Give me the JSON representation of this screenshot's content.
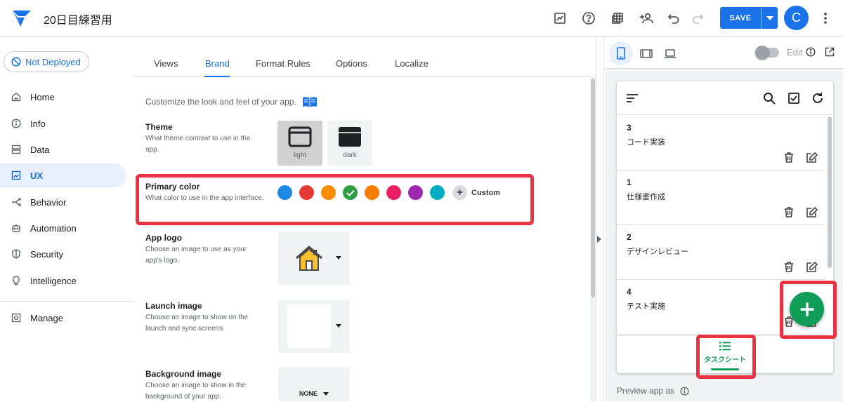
{
  "app": {
    "title": "20日目練習用"
  },
  "topbar": {
    "icons": [
      "chart-icon",
      "help-icon",
      "grid-icon",
      "add-person-icon",
      "undo-icon",
      "redo-icon"
    ],
    "save_label": "SAVE",
    "avatar_initial": "C"
  },
  "sidebar": {
    "deploy_status": "Not Deployed",
    "items": [
      {
        "label": "Home",
        "icon": "home-icon"
      },
      {
        "label": "Info",
        "icon": "info-icon"
      },
      {
        "label": "Data",
        "icon": "data-icon"
      },
      {
        "label": "UX",
        "icon": "ux-icon",
        "active": true
      },
      {
        "label": "Behavior",
        "icon": "behavior-icon"
      },
      {
        "label": "Automation",
        "icon": "automation-icon"
      },
      {
        "label": "Security",
        "icon": "security-icon"
      },
      {
        "label": "Intelligence",
        "icon": "lightbulb-icon"
      },
      {
        "label": "Manage",
        "icon": "manage-icon"
      }
    ]
  },
  "main": {
    "tabs": [
      {
        "label": "Views"
      },
      {
        "label": "Brand",
        "active": true
      },
      {
        "label": "Format Rules"
      },
      {
        "label": "Options"
      },
      {
        "label": "Localize"
      }
    ],
    "intro": "Customize the look and feel of your app.",
    "theme": {
      "title": "Theme",
      "desc": "What theme contrast to use in the app.",
      "options": [
        {
          "label": "light",
          "selected": true
        },
        {
          "label": "dark"
        }
      ]
    },
    "primary_color": {
      "title": "Primary color",
      "desc": "What color to use in the app interface.",
      "swatches": [
        "#1e88e5",
        "#e53935",
        "#fb8c00",
        "#2e9e45",
        "#f57c00",
        "#e91e63",
        "#9c27b0",
        "#00acc1"
      ],
      "selected_index": 3,
      "custom_label": "Custom"
    },
    "app_logo": {
      "title": "App logo",
      "desc": "Choose an image to use as your app's logo."
    },
    "launch_image": {
      "title": "Launch image",
      "desc": "Choose an image to show on the launch and sync screens."
    },
    "background_image": {
      "title": "Background image",
      "desc": "Choose an image to show in the background of your app.",
      "value": "NONE"
    }
  },
  "preview": {
    "edit_label": "Edit",
    "tasks": [
      {
        "num": "3",
        "name": "コード実装"
      },
      {
        "num": "1",
        "name": "仕様書作成"
      },
      {
        "num": "2",
        "name": "デザインレビュー"
      },
      {
        "num": "4",
        "name": "テスト実施"
      }
    ],
    "bottom_tab_label": "タスクシート",
    "preview_as_label": "Preview app as"
  },
  "colors": {
    "accent": "#1a73e8",
    "app_green": "#0f9d58",
    "highlight": "#ea3342"
  }
}
